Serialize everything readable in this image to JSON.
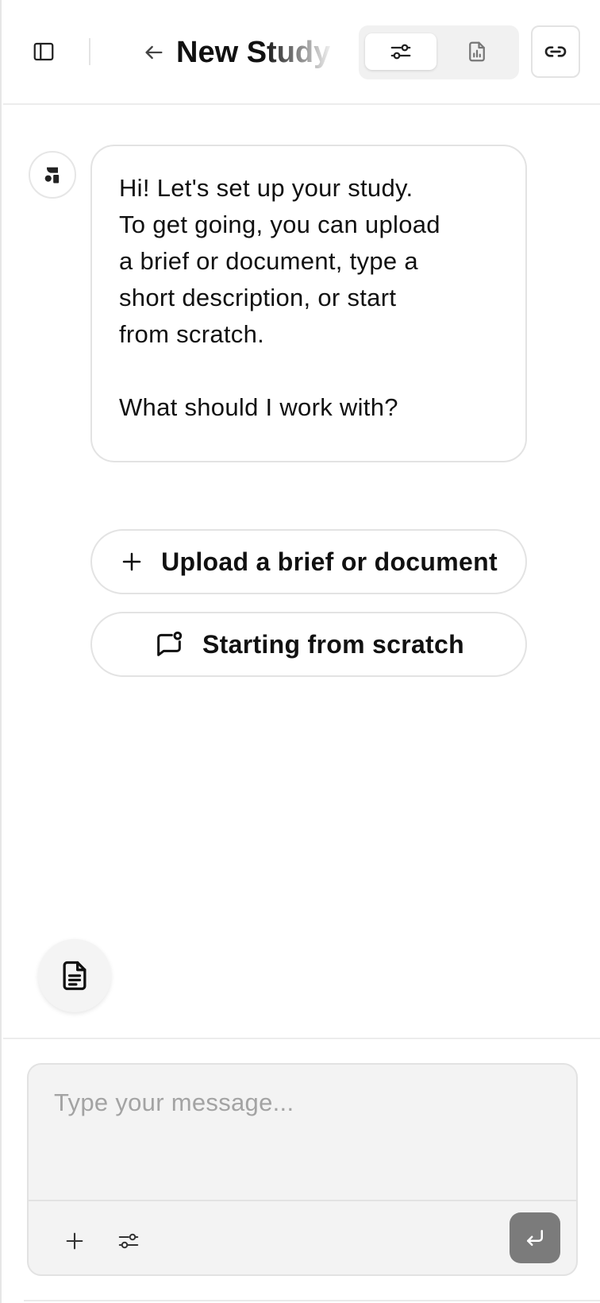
{
  "header": {
    "title": "New Study",
    "icons": {
      "sidebar_toggle": "sidebar-icon",
      "back": "arrow-left-icon",
      "settings_tab": "sliders-icon",
      "report_tab": "document-chart-icon",
      "share": "link-icon"
    },
    "active_tab": "settings"
  },
  "chat": {
    "assistant_avatar": "logo-icon",
    "message_lines": [
      "Hi! Let's set up your study.",
      "To get going, you can upload",
      "a brief or document, type a",
      "short description, or start",
      "from scratch."
    ],
    "message_question": "What should I work with?",
    "actions": {
      "upload_label": "Upload a brief or document",
      "upload_icon": "plus-icon",
      "scratch_label": "Starting from scratch",
      "scratch_icon": "chat-new-icon"
    },
    "document_button_icon": "document-icon"
  },
  "composer": {
    "placeholder": "Type your message...",
    "value": "",
    "attach_icon": "plus-icon",
    "settings_icon": "sliders-icon",
    "send_icon": "enter-arrow-icon"
  },
  "colors": {
    "border": "#e3e3e3",
    "composer_bg": "#f3f3f3",
    "send_bg": "#7b7b7b",
    "text": "#111111",
    "placeholder": "#a3a3a3"
  }
}
